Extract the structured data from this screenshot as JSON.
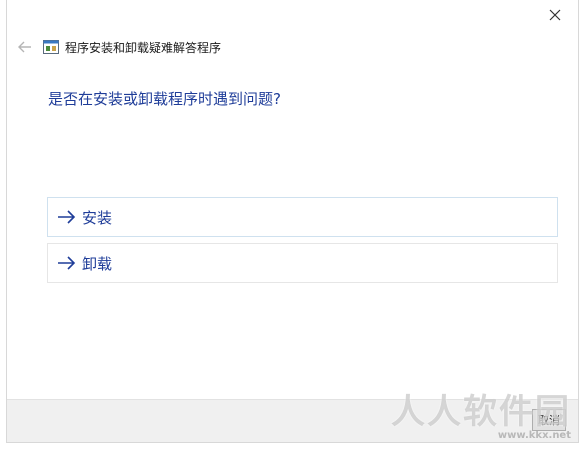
{
  "window": {
    "title": "程序安装和卸载疑难解答程序"
  },
  "main": {
    "question": "是否在安装或卸载程序时遇到问题?",
    "options": [
      {
        "label": "安装"
      },
      {
        "label": "卸载"
      }
    ]
  },
  "footer": {
    "cancel_label": "取消"
  },
  "watermark": {
    "main": "人人软件园",
    "url": "www.kkx.net"
  },
  "colors": {
    "accent": "#1f3d99",
    "footer_bg": "#f0f0f0",
    "selected_border": "#cfe1ef"
  }
}
